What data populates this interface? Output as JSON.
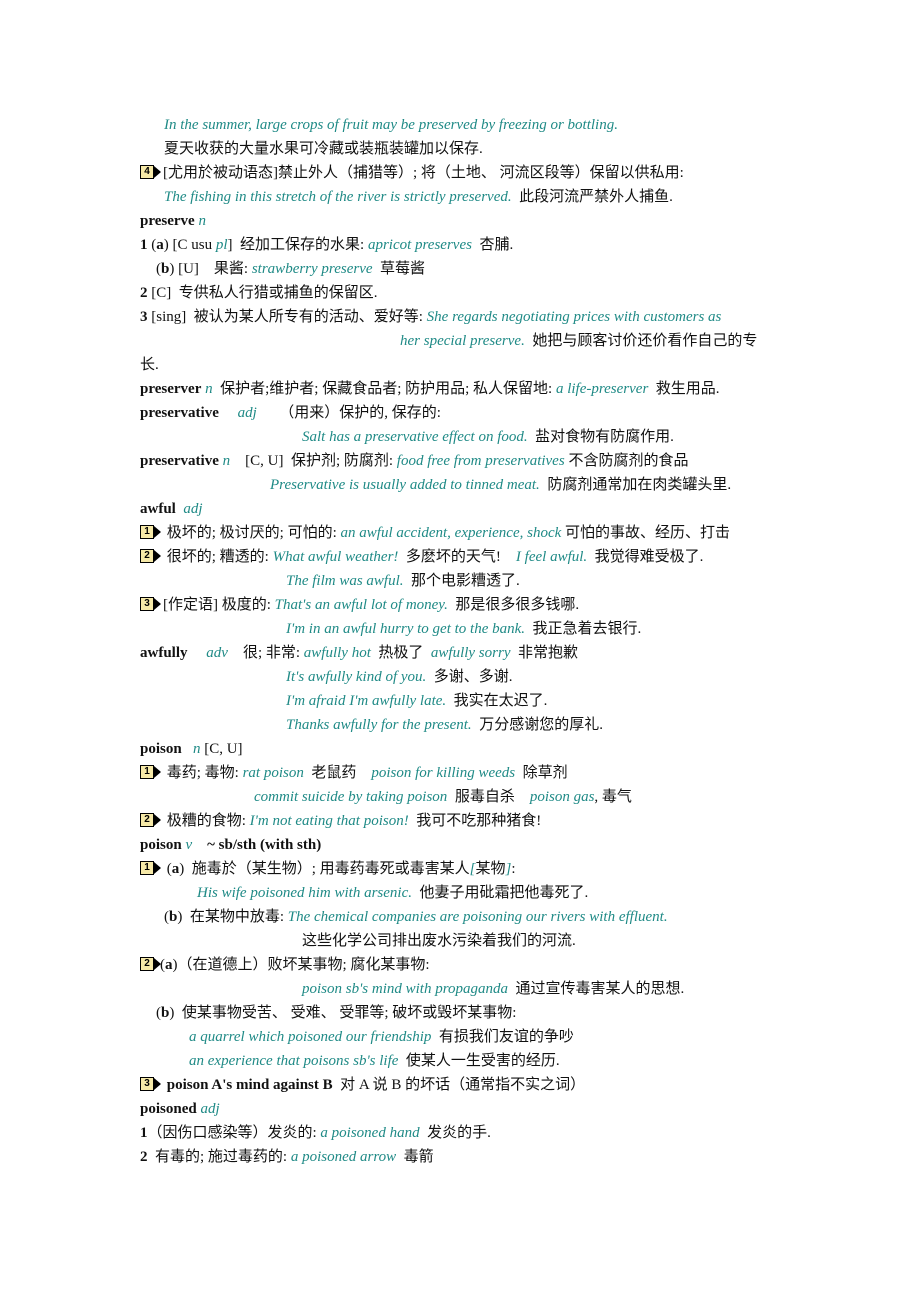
{
  "colors": {
    "example_text": "#1f8a86",
    "body_text": "#111111",
    "icon_fill": "#f6e9a8"
  },
  "lines": {
    "l1": {
      "ex": "In the summer, large crops of fruit may be preserved by freezing or bottling."
    },
    "l2": {
      "zh": "夏天收获的大量水果可冷藏或装瓶装罐加以保存."
    },
    "l3": {
      "icon": "4",
      "zh": "[尤用於被动语态]禁止外人（捕猎等）; 将（土地、 河流区段等）保留以供私用:"
    },
    "l4": {
      "ex": "The fishing in this stretch of the river is strictly preserved.",
      "zh": "此段河流严禁外人捕鱼."
    },
    "l5": {
      "hw": "preserve",
      "pos": "n"
    },
    "l6": {
      "num": "1",
      "sub": "(a)",
      "gram1": "[C usu ",
      "gram_pos": "pl",
      "gram2": "]",
      "zh": "经加工保存的水果:",
      "ex": "apricot preserves",
      "zh2": "杏脯."
    },
    "l7": {
      "sub": "(b)",
      "gram": "[U]",
      "zh": "果酱:",
      "ex": "strawberry preserve",
      "zh2": "草莓酱"
    },
    "l8": {
      "num": "2",
      "gram": "[C]",
      "zh": "专供私人行猎或捕鱼的保留区."
    },
    "l9": {
      "num": "3",
      "gram": "[sing]",
      "zh": "被认为某人所专有的活动、爱好等:",
      "ex": "She regards negotiating prices with customers as"
    },
    "l10": {
      "ex": "her special preserve.",
      "zh": "她把与顾客讨价还价看作自己的专"
    },
    "l11": {
      "zh": "长."
    },
    "l12": {
      "hw": "preserver",
      "pos": "n",
      "zh": "保护者;维护者; 保藏食品者; 防护用品; 私人保留地:",
      "ex": "a life-preserver",
      "zh2": "救生用品."
    },
    "l13": {
      "hw": "preservative",
      "pos": "adj",
      "zh": "（用来）保护的, 保存的:"
    },
    "l14": {
      "ex": "Salt has a preservative effect on food.",
      "zh": "盐对食物有防腐作用."
    },
    "l15": {
      "hw": "preservative",
      "pos": "n",
      "gram": "[C, U]",
      "zh": "保护剂; 防腐剂:",
      "ex": "food free from preservatives",
      "zh2": "不含防腐剂的食品"
    },
    "l16": {
      "ex": "Preservative is usually added to tinned meat.",
      "zh": "防腐剂通常加在肉类罐头里."
    },
    "l17": {
      "hw": "awful",
      "pos": "adj"
    },
    "l18": {
      "icon": "1",
      "zh": "极坏的; 极讨厌的; 可怕的:",
      "ex": "an awful accident, experience, shock",
      "zh2": "可怕的事故、经历、打击"
    },
    "l19": {
      "icon": "2",
      "zh": "很坏的; 糟透的:",
      "ex": "What awful weather!",
      "zh2": "多麽坏的天气!",
      "ex2": "I feel awful.",
      "zh3": "我觉得难受极了."
    },
    "l20": {
      "ex": "The film was awful.",
      "zh": "那个电影糟透了."
    },
    "l21": {
      "icon": "3",
      "zh": "[作定语]  极度的:",
      "ex": "That's an awful lot of money.",
      "zh2": "那是很多很多钱哪."
    },
    "l22": {
      "ex": "I'm in an awful hurry to get to the bank.",
      "zh": "我正急着去银行."
    },
    "l23": {
      "hw": "awfully",
      "pos": "adv",
      "zh": "很; 非常:",
      "ex": "awfully hot",
      "zh2": "热极了",
      "ex2": "awfully sorry",
      "zh3": "非常抱歉"
    },
    "l24": {
      "ex": "It's awfully kind of you.",
      "zh": "多谢、多谢."
    },
    "l25": {
      "ex": "I'm afraid I'm awfully late.",
      "zh": "我实在太迟了."
    },
    "l26": {
      "ex": "Thanks awfully for the present.",
      "zh": "万分感谢您的厚礼."
    },
    "l27": {
      "hw": "poison",
      "pos": "n",
      "gram": "[C, U]"
    },
    "l28": {
      "icon": "1",
      "zh": "毒药; 毒物:",
      "ex": "rat poison",
      "zh2": "老鼠药",
      "ex2": "poison for killing weeds",
      "zh3": "除草剂"
    },
    "l29": {
      "ex": "commit suicide by taking poison",
      "zh": "服毒自杀",
      "ex2": "poison gas",
      "zh2": ", 毒气"
    },
    "l30": {
      "icon": "2",
      "zh": "极糟的食物:",
      "ex": "I'm not eating that poison!",
      "zh2": "我可不吃那种猪食!"
    },
    "l31": {
      "hw": "poison",
      "pos": "v",
      "gram": "~ sb/sth (with sth)"
    },
    "l32": {
      "icon": "1",
      "sub": "(a)",
      "zh": "施毒於（某生物）; 用毒药毒死或毒害某人",
      "ex": "[",
      "zh2": "某物",
      "ex2": "]",
      "zh3": ":"
    },
    "l33": {
      "ex": "His wife poisoned him with arsenic.",
      "zh": "他妻子用砒霜把他毒死了."
    },
    "l34": {
      "sub": "(b)",
      "zh": "在某物中放毒:",
      "ex": "The chemical companies are poisoning our rivers with effluent."
    },
    "l35": {
      "zh": "这些化学公司排出废水污染着我们的河流."
    },
    "l36": {
      "icon": "2",
      "sub": "(a)",
      "zh": "（在道德上）败坏某事物; 腐化某事物:"
    },
    "l37": {
      "ex": "poison sb's mind with propaganda",
      "zh": "通过宣传毒害某人的思想."
    },
    "l38": {
      "sub": "(b)",
      "zh": "使某事物受苦、 受难、 受罪等; 破坏或毁坏某事物:"
    },
    "l39": {
      "ex": "a quarrel which poisoned our friendship",
      "zh": "有损我们友谊的争吵"
    },
    "l40": {
      "ex": "an experience that poisons sb's life",
      "zh": "使某人一生受害的经历."
    },
    "l41": {
      "icon": "3",
      "phrase": "poison A's mind against B",
      "zh": "对 A 说 B 的坏话（通常指不实之词）"
    },
    "l42": {
      "hw": "poisoned",
      "pos": "adj"
    },
    "l43": {
      "num": "1",
      "zh": "（因伤口感染等）发炎的:",
      "ex": "a poisoned hand",
      "zh2": "发炎的手."
    },
    "l44": {
      "num": "2",
      "zh": "有毒的; 施过毒药的:",
      "ex": "a poisoned arrow",
      "zh2": "毒箭"
    }
  }
}
